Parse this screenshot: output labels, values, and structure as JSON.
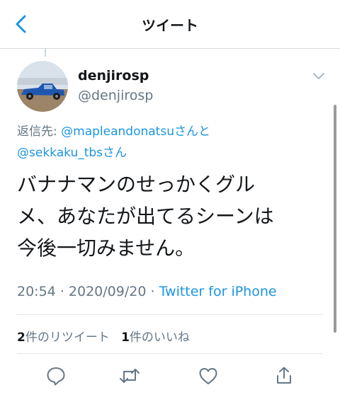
{
  "nav": {
    "title": "ツイート",
    "back_icon": "chevron-left-icon"
  },
  "tweet": {
    "display_name": "denjirosp",
    "handle": "@denjirosp",
    "reply_prefix": "返信先:",
    "reply_to_1": "@mapleandonatsu",
    "reply_joiner_1": "さんと",
    "reply_to_2": "@sekkaku_tbs",
    "reply_joiner_2": "さん",
    "text_line_1": "バナナマンのせっかくグル",
    "text_line_2": "メ、あなたが出てるシーンは",
    "text_line_3": "今後一切みません。",
    "time": "20:54",
    "dot": "·",
    "date": "2020/09/20",
    "source": "Twitter for iPhone"
  },
  "stats": {
    "retweet_count": "2",
    "retweet_label": "件のリツイート",
    "like_count": "1",
    "like_label": "件のいいね"
  },
  "actions": [
    "reply-icon",
    "retweet-icon",
    "like-icon",
    "share-icon"
  ],
  "colors": {
    "accent": "#1b95e0",
    "text": "#14171a",
    "secondary": "#657786",
    "divider": "#e1e8ed"
  }
}
